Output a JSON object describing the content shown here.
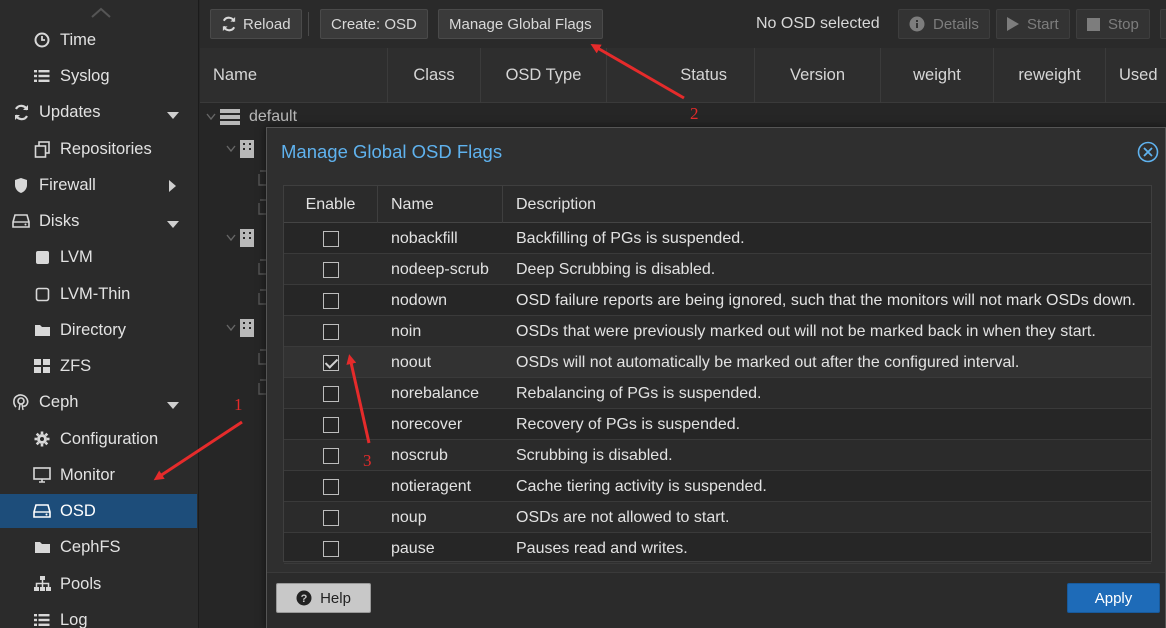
{
  "sidebar": {
    "items": [
      {
        "label": "Time",
        "icon": "clock-icon",
        "level": 2
      },
      {
        "label": "Syslog",
        "icon": "list-icon",
        "level": 2
      },
      {
        "label": "Updates",
        "icon": "refresh-icon",
        "level": 1,
        "expandable": "down"
      },
      {
        "label": "Repositories",
        "icon": "files-icon",
        "level": 2
      },
      {
        "label": "Firewall",
        "icon": "shield-icon",
        "level": 1,
        "expandable": "right"
      },
      {
        "label": "Disks",
        "icon": "hdd-icon",
        "level": 1,
        "expandable": "down"
      },
      {
        "label": "LVM",
        "icon": "square-icon",
        "level": 2
      },
      {
        "label": "LVM-Thin",
        "icon": "square-outline-icon",
        "level": 2
      },
      {
        "label": "Directory",
        "icon": "folder-icon",
        "level": 2
      },
      {
        "label": "ZFS",
        "icon": "grid-icon",
        "level": 2
      },
      {
        "label": "Ceph",
        "icon": "ceph-icon",
        "level": 1,
        "expandable": "down"
      },
      {
        "label": "Configuration",
        "icon": "gear-icon",
        "level": 2
      },
      {
        "label": "Monitor",
        "icon": "monitor-icon",
        "level": 2
      },
      {
        "label": "OSD",
        "icon": "hdd-icon",
        "level": 2,
        "selected": true
      },
      {
        "label": "CephFS",
        "icon": "folder-icon",
        "level": 2
      },
      {
        "label": "Pools",
        "icon": "sitemap-icon",
        "level": 2
      },
      {
        "label": "Log",
        "icon": "list-icon",
        "level": 2
      }
    ]
  },
  "toolbar": {
    "reload": "Reload",
    "create_osd": "Create: OSD",
    "manage_flags": "Manage Global Flags",
    "status": "No OSD selected",
    "details": "Details",
    "start": "Start",
    "stop": "Stop"
  },
  "grid": {
    "columns": [
      "Name",
      "Class",
      "OSD Type",
      "Status",
      "Version",
      "weight",
      "reweight",
      "Used"
    ],
    "tree_root": "default"
  },
  "modal": {
    "title": "Manage Global OSD Flags",
    "columns": {
      "enable": "Enable",
      "name": "Name",
      "description": "Description"
    },
    "rows": [
      {
        "name": "nobackfill",
        "description": "Backfilling of PGs is suspended.",
        "enabled": false
      },
      {
        "name": "nodeep-scrub",
        "description": "Deep Scrubbing is disabled.",
        "enabled": false
      },
      {
        "name": "nodown",
        "description": "OSD failure reports are being ignored, such that the monitors will not mark OSDs down.",
        "enabled": false
      },
      {
        "name": "noin",
        "description": "OSDs that were previously marked out will not be marked back in when they start.",
        "enabled": false
      },
      {
        "name": "noout",
        "description": "OSDs will not automatically be marked out after the configured interval.",
        "enabled": true
      },
      {
        "name": "norebalance",
        "description": "Rebalancing of PGs is suspended.",
        "enabled": false
      },
      {
        "name": "norecover",
        "description": "Recovery of PGs is suspended.",
        "enabled": false
      },
      {
        "name": "noscrub",
        "description": "Scrubbing is disabled.",
        "enabled": false
      },
      {
        "name": "notieragent",
        "description": "Cache tiering activity is suspended.",
        "enabled": false
      },
      {
        "name": "noup",
        "description": "OSDs are not allowed to start.",
        "enabled": false
      },
      {
        "name": "pause",
        "description": "Pauses read and writes.",
        "enabled": false
      }
    ],
    "help": "Help",
    "apply": "Apply"
  },
  "annotations": {
    "one": "1",
    "two": "2",
    "three": "3",
    "color": "#e52b2b"
  },
  "colors": {
    "selected": "#1d4d7a",
    "title": "#5fb2ee",
    "apply": "#1e6bb8"
  }
}
